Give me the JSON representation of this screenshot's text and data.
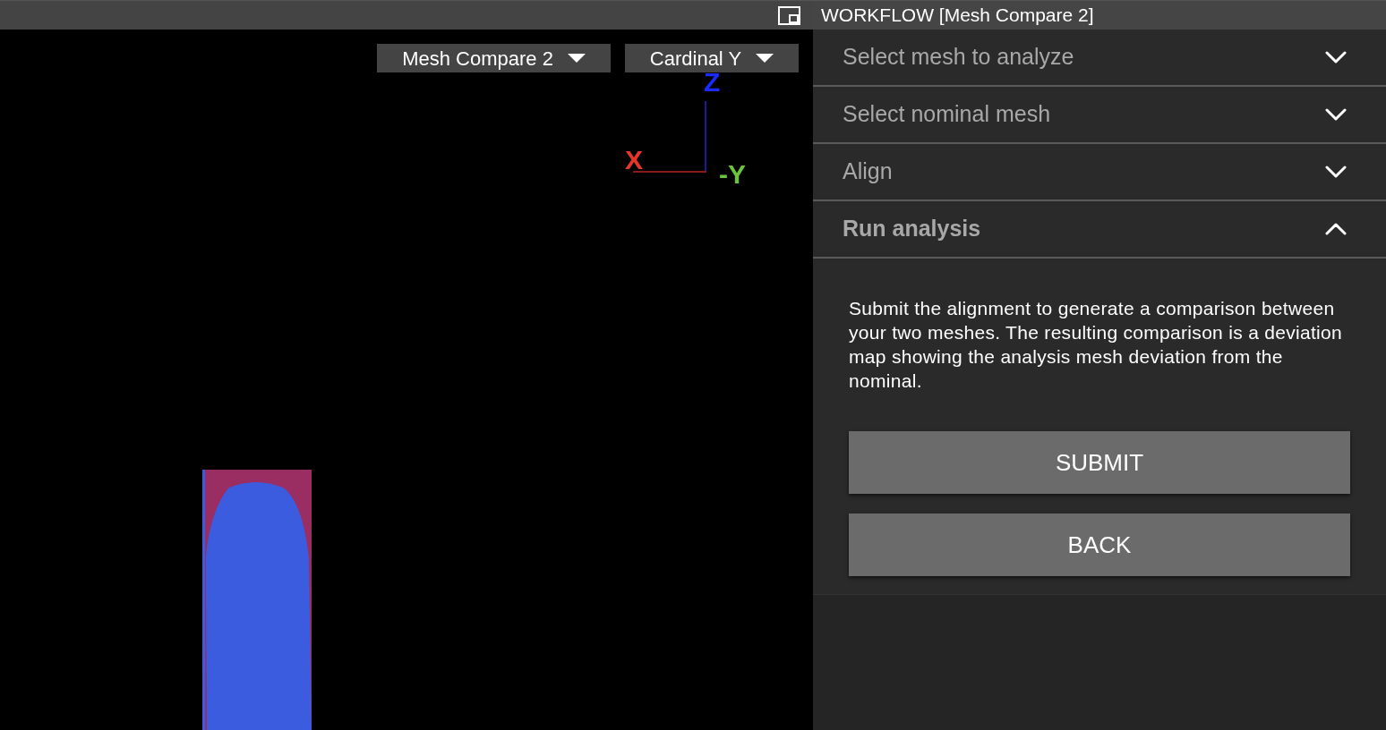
{
  "viewport": {
    "dropdowns": [
      {
        "label": "Mesh Compare 2"
      },
      {
        "label": "Cardinal Y"
      }
    ],
    "axes": [
      {
        "label": "Z",
        "color": "#1a2bff"
      },
      {
        "label": "X",
        "color": "#e8362b"
      },
      {
        "label": "-Y",
        "color": "#6cc43a"
      }
    ]
  },
  "workflow": {
    "title": "WORKFLOW [Mesh Compare 2]",
    "sections": [
      {
        "title": "Select mesh to analyze",
        "expanded": false
      },
      {
        "title": "Select nominal mesh",
        "expanded": false
      },
      {
        "title": "Align",
        "expanded": false
      },
      {
        "title": "Run analysis",
        "expanded": true,
        "description": "Submit the alignment to generate a comparison between your two meshes. The resulting comparison is a deviation map showing the analysis mesh deviation from the nominal.",
        "buttons": [
          "SUBMIT",
          "BACK"
        ]
      }
    ]
  }
}
